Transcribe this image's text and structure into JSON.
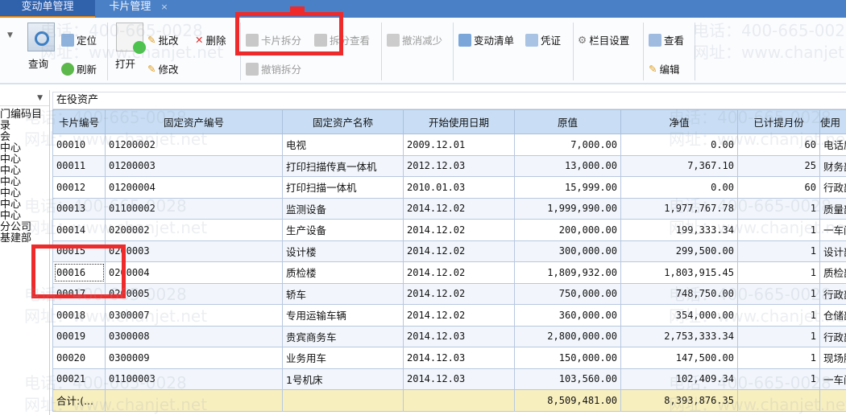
{
  "tabs": [
    {
      "label": "变动单管理"
    },
    {
      "label": "卡片管理",
      "close": "×"
    }
  ],
  "toolbar": {
    "query": "查询",
    "locate": "定位",
    "refresh": "刷新",
    "open": "打开",
    "batch_edit": "批改",
    "edit": "修改",
    "delete": "删除",
    "card_split": "卡片拆分",
    "split_view": "拆分查看",
    "undo_split": "撤销拆分",
    "undo_reduce": "撤消减少",
    "change_list": "变动清单",
    "voucher": "凭证",
    "column_settings": "栏目设置",
    "view": "查看",
    "editor": "编辑"
  },
  "left_panel": {
    "items": [
      "门编码目录",
      "会",
      "中心",
      "中心",
      "中心",
      "中心",
      "中心",
      "中心",
      "中心",
      "分公司",
      "基建部"
    ]
  },
  "grid": {
    "title": "在役资产",
    "columns": [
      "卡片编号",
      "固定资产编号",
      "固定资产名称",
      "开始使用日期",
      "原值",
      "净值",
      "已计提月份",
      "使用"
    ],
    "rows": [
      [
        "00010",
        "01200002",
        "电视",
        "2009.12.01",
        "7,000.00",
        "0.00",
        "60",
        "电话房"
      ],
      [
        "00011",
        "01200003",
        "打印扫描传真一体机",
        "2012.12.03",
        "13,000.00",
        "7,367.10",
        "25",
        "财务部"
      ],
      [
        "00012",
        "01200004",
        "打印扫描一体机",
        "2010.01.03",
        "15,999.00",
        "0.00",
        "60",
        "行政部"
      ],
      [
        "00013",
        "01100002",
        "监测设备",
        "2014.12.02",
        "1,999,990.00",
        "1,977,767.78",
        "1",
        "质量部"
      ],
      [
        "00014",
        "0200002",
        "生产设备",
        "2014.12.02",
        "200,000.00",
        "199,333.34",
        "1",
        "一车间"
      ],
      [
        "00015",
        "0200003",
        "设计楼",
        "2014.12.02",
        "300,000.00",
        "299,500.00",
        "1",
        "设计部"
      ],
      [
        "00016",
        "0200004",
        "质检楼",
        "2014.12.02",
        "1,809,932.00",
        "1,803,915.45",
        "1",
        "质检部"
      ],
      [
        "00017",
        "0200005",
        "轿车",
        "2014.12.02",
        "750,000.00",
        "748,750.00",
        "1",
        "行政部"
      ],
      [
        "00018",
        "0300007",
        "专用运输车辆",
        "2014.12.02",
        "360,000.00",
        "354,000.00",
        "1",
        "仓储部"
      ],
      [
        "00019",
        "0300008",
        "贵宾商务车",
        "2014.12.03",
        "2,800,000.00",
        "2,753,333.34",
        "1",
        "行政部"
      ],
      [
        "00020",
        "0300009",
        "业务用车",
        "2014.12.03",
        "150,000.00",
        "147,500.00",
        "1",
        "现场服"
      ],
      [
        "00021",
        "01100003",
        "1号机床",
        "2014.12.03",
        "103,560.00",
        "102,409.34",
        "1",
        "一车间"
      ]
    ],
    "total": {
      "label": "合计:(...",
      "original": "8,509,481.00",
      "net": "8,393,876.35"
    }
  },
  "watermark": {
    "phone": "电话：400-665-0028",
    "site": "网址：www.chanjet.net"
  },
  "colors": {
    "tab_bar": "#4a80c6",
    "header": "#c9def5",
    "total_row": "#f8efbf",
    "annotation": "#ee2a2a"
  }
}
